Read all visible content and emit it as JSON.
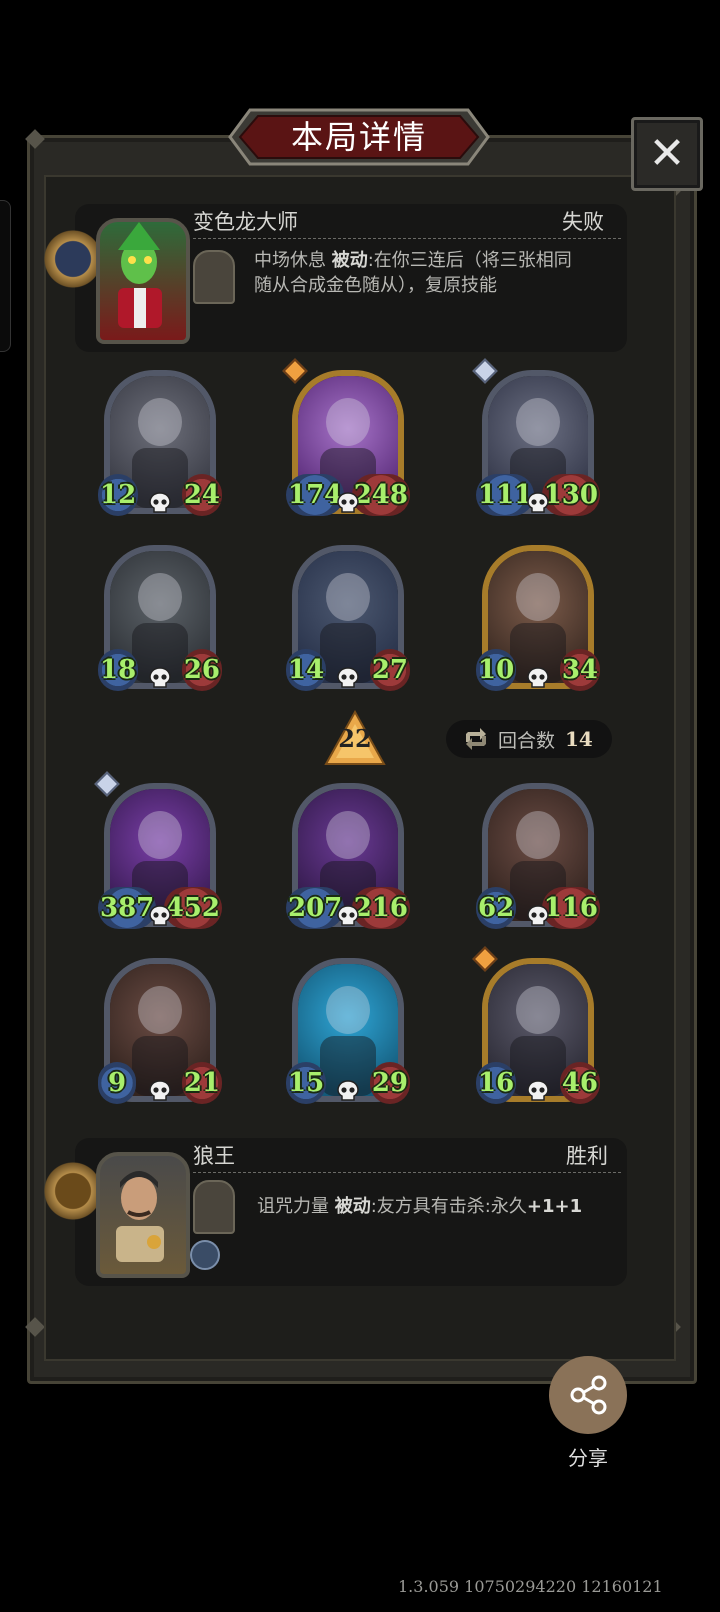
{
  "dialog": {
    "title": "本局详情",
    "close_icon": "✕"
  },
  "opponent": {
    "name": "变色龙大师",
    "result": "失败",
    "skill_name": "中场休息",
    "skill_type": "被动",
    "skill_desc_line1": ":在你三连后（将三张相同",
    "skill_desc_line2": "随从合成金色随从），复原技能"
  },
  "board_top": [
    {
      "attack": "12",
      "health": "24",
      "frame": "silver",
      "tier_gem": "",
      "art": "robot-heart",
      "colors": [
        "#6d6f7a",
        "#3a3c46"
      ]
    },
    {
      "attack": "174",
      "health": "248",
      "frame": "gold",
      "tier_gem": "gold",
      "art": "cannon",
      "colors": [
        "#a774c9",
        "#5a2c7a"
      ]
    },
    {
      "attack": "111",
      "health": "130",
      "frame": "silver",
      "tier_gem": "silver",
      "art": "knight",
      "colors": [
        "#6b6f82",
        "#34384a"
      ]
    },
    {
      "attack": "18",
      "health": "26",
      "frame": "silver",
      "tier_gem": "",
      "art": "robot",
      "colors": [
        "#5c6268",
        "#2f3338"
      ]
    },
    {
      "attack": "14",
      "health": "27",
      "frame": "silver",
      "tier_gem": "",
      "art": "robo-dog",
      "colors": [
        "#4c5870",
        "#28324a"
      ]
    },
    {
      "attack": "10",
      "health": "34",
      "frame": "gold",
      "tier_gem": "",
      "art": "zombie-girl",
      "colors": [
        "#7c5b4a",
        "#3a2a22"
      ]
    }
  ],
  "level": "22",
  "rounds": {
    "label": "回合数",
    "value": "14"
  },
  "board_bottom": [
    {
      "attack": "387",
      "health": "452",
      "frame": "silver",
      "tier_gem": "silver",
      "art": "lich",
      "colors": [
        "#7a3fa8",
        "#3a1c55"
      ]
    },
    {
      "attack": "207",
      "health": "216",
      "frame": "silver",
      "tier_gem": "",
      "art": "lich",
      "colors": [
        "#6a3a94",
        "#321a4a"
      ]
    },
    {
      "attack": "62",
      "health": "116",
      "frame": "silver",
      "tier_gem": "",
      "art": "zombie-girl",
      "colors": [
        "#6b4c44",
        "#33241f"
      ]
    },
    {
      "attack": "9",
      "health": "21",
      "frame": "silver",
      "tier_gem": "",
      "art": "zombie-girl",
      "colors": [
        "#6b4c44",
        "#33241f"
      ]
    },
    {
      "attack": "15",
      "health": "29",
      "frame": "silver",
      "tier_gem": "",
      "art": "reaper",
      "colors": [
        "#2fa6d6",
        "#145a7a"
      ]
    },
    {
      "attack": "16",
      "health": "46",
      "frame": "gold",
      "tier_gem": "gold",
      "art": "nun",
      "colors": [
        "#5b5a6a",
        "#2c2b36"
      ]
    }
  ],
  "player": {
    "name": "狼王",
    "result": "胜利",
    "skill_name": "诅咒力量",
    "skill_type": "被动",
    "skill_desc": ":友方具有击杀:永久",
    "skill_bonus": "+1+1"
  },
  "share": {
    "label": "分享"
  },
  "version": "1.3.059 10750294220 12160121"
}
